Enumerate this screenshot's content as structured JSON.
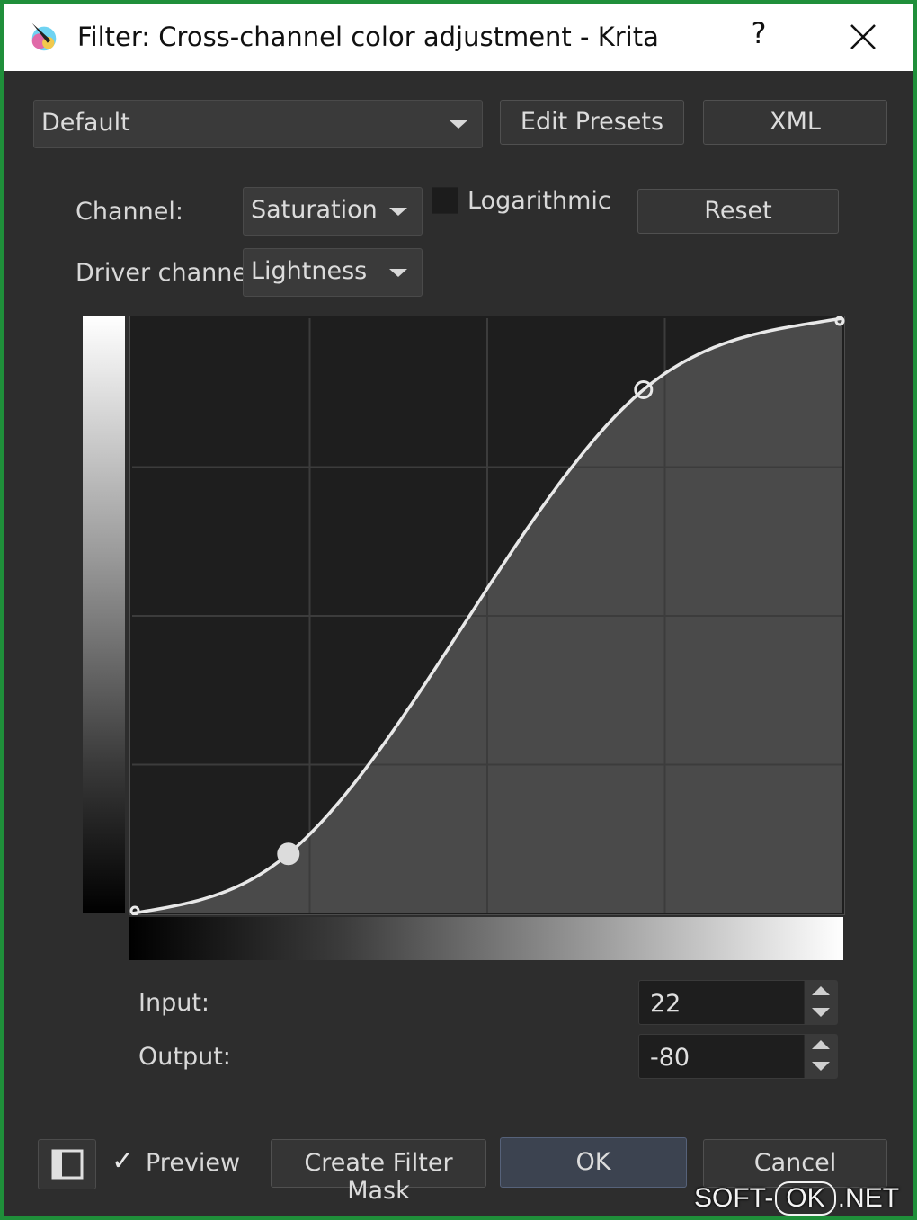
{
  "window": {
    "title": "Filter: Cross-channel color adjustment - Krita",
    "help": "?",
    "accent": "#1f8f3a"
  },
  "presets": {
    "selected": "Default",
    "edit_presets": "Edit Presets",
    "xml": "XML"
  },
  "channel": {
    "label": "Channel:",
    "value": "Saturation",
    "logarithmic": "Logarithmic",
    "logarithmic_checked": false,
    "reset": "Reset"
  },
  "driver": {
    "label": "Driver channel",
    "value": "Lightness"
  },
  "curve": {
    "points": [
      {
        "x": 0.0,
        "y": 0.0,
        "selected": false
      },
      {
        "x": 0.22,
        "y": 0.1,
        "selected": true
      },
      {
        "x": 0.72,
        "y": 0.88,
        "selected": false
      },
      {
        "x": 1.0,
        "y": 1.0,
        "selected": false
      }
    ]
  },
  "io": {
    "input_label": "Input:",
    "input_value": "22",
    "output_label": "Output:",
    "output_value": "-80"
  },
  "footer": {
    "preview_label": "Preview",
    "preview_checked": true,
    "create_mask": "Create Filter Mask",
    "ok": "OK",
    "cancel": "Cancel"
  },
  "watermark": {
    "left": "SOFT-",
    "box": "OK",
    "right": ".NET"
  }
}
